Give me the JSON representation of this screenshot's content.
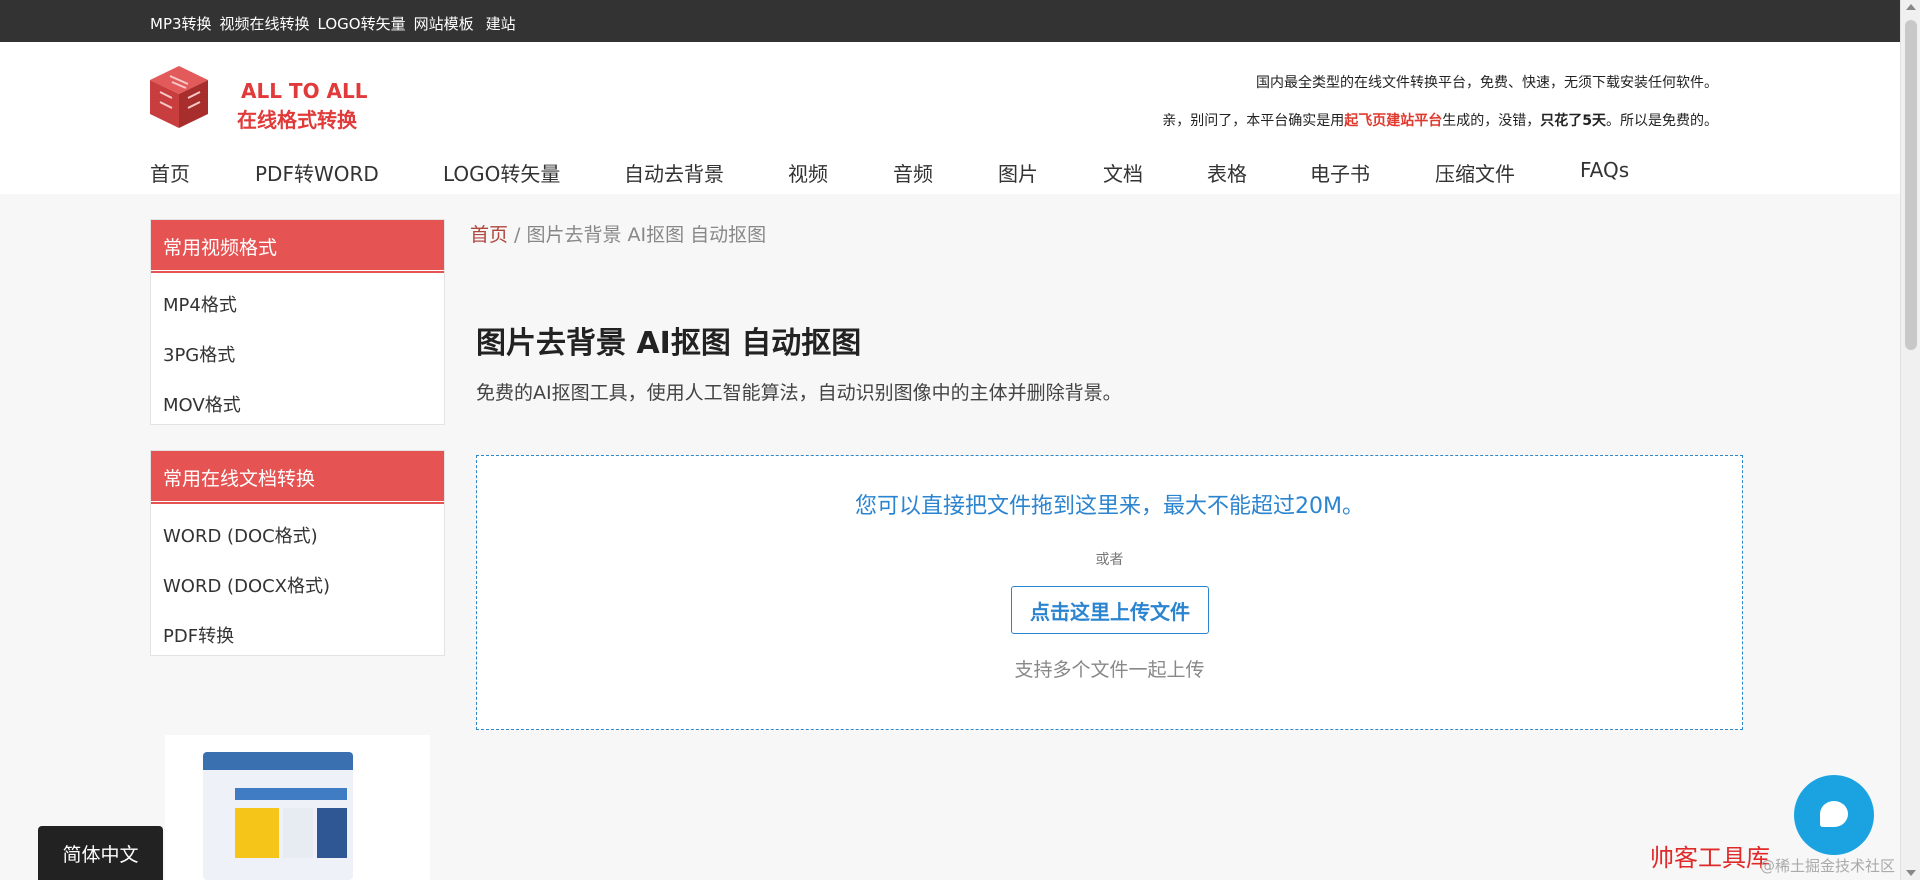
{
  "topbar": {
    "links": [
      "MP3转换",
      "视频在线转换",
      "LOGO转矢量",
      "网站模板",
      "建站"
    ]
  },
  "brand": {
    "en": "ALL TO ALL",
    "cn": "在线格式转换",
    "slogan": "国内最全类型的在线文件转换平台，免费、快速，无须下载安装任何软件。",
    "notice_prefix": "亲，别问了，本平台确实是用",
    "notice_highlight": "起飞页建站平台",
    "notice_middle": "生成的，没错，",
    "notice_bold": "只花了5天",
    "notice_suffix": "。所以是免费的。"
  },
  "nav": {
    "items": [
      "首页",
      "PDF转WORD",
      "LOGO转矢量",
      "自动去背景",
      "视频",
      "音频",
      "图片",
      "文档",
      "表格",
      "电子书",
      "压缩文件",
      "FAQs"
    ]
  },
  "sidebar": {
    "video": {
      "title": "常用视频格式",
      "items": [
        "MP4格式",
        "3PG格式",
        "MOV格式"
      ]
    },
    "docs": {
      "title": "常用在线文档转换",
      "items": [
        "WORD (DOC格式)",
        "WORD (DOCX格式)",
        "PDF转换"
      ]
    }
  },
  "breadcrumb": {
    "home": "首页",
    "separator": " / ",
    "current": "图片去背景 AI抠图 自动抠图"
  },
  "main": {
    "title": "图片去背景 AI抠图 自动抠图",
    "description": "免费的AI抠图工具，使用人工智能算法，自动识别图像中的主体并删除背景。"
  },
  "upload": {
    "tip": "您可以直接把文件拖到这里来，最大不能超过20M。",
    "or": "或者",
    "button": "点击这里上传文件",
    "multi": "支持多个文件一起上传"
  },
  "language": "简体中文",
  "watermark": {
    "red": "帅客工具库",
    "gray": "@稀土掘金技术社区"
  },
  "colors": {
    "accent": "#e55353",
    "link_blue": "#2b84d0",
    "topbar": "#333333"
  }
}
